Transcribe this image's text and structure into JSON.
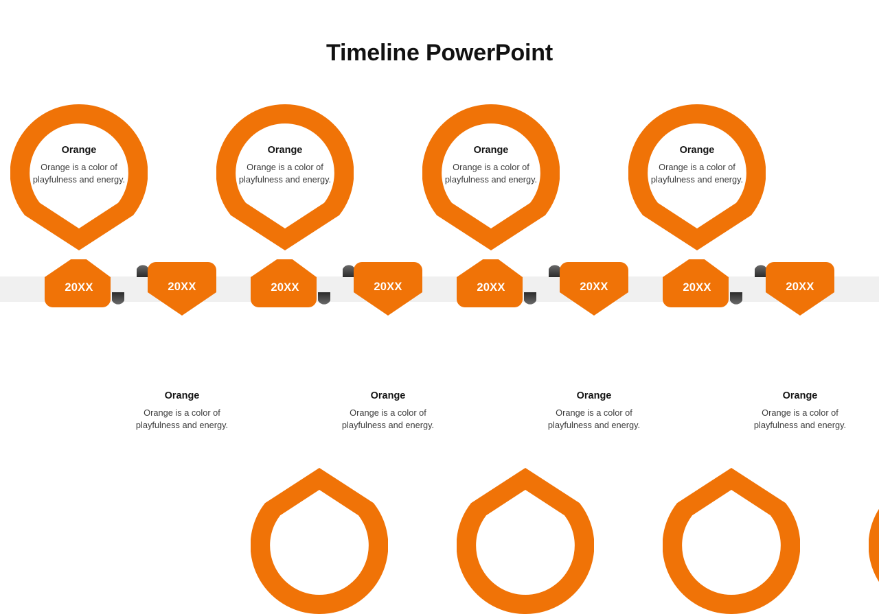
{
  "slide": {
    "title": "Timeline PowerPoint",
    "background_color": "#ffffff",
    "accent_color": "#f07307",
    "band_color": "#f0f0f0",
    "fold_color": "#3d3d3d",
    "heading_color": "#141414",
    "body_color": "#3c3c3c",
    "badge_text_color": "#ffffff"
  },
  "timeline": {
    "band_label": "timeline-band",
    "items": [
      {
        "year": "20XX",
        "position": "above",
        "heading": "Orange",
        "body": "Orange is a color of playfulness and energy."
      },
      {
        "year": "20XX",
        "position": "below",
        "heading": "Orange",
        "body": "Orange is a color of playfulness and energy."
      },
      {
        "year": "20XX",
        "position": "above",
        "heading": "Orange",
        "body": "Orange is a color of playfulness and energy."
      },
      {
        "year": "20XX",
        "position": "below",
        "heading": "Orange",
        "body": "Orange is a color of playfulness and energy."
      },
      {
        "year": "20XX",
        "position": "above",
        "heading": "Orange",
        "body": "Orange is a color of playfulness and energy."
      },
      {
        "year": "20XX",
        "position": "below",
        "heading": "Orange",
        "body": "Orange is a color of playfulness and energy."
      },
      {
        "year": "20XX",
        "position": "above",
        "heading": "Orange",
        "body": "Orange is a color of playfulness and energy."
      },
      {
        "year": "20XX",
        "position": "below",
        "heading": "Orange",
        "body": "Orange is a color of playfulness and energy."
      }
    ]
  }
}
